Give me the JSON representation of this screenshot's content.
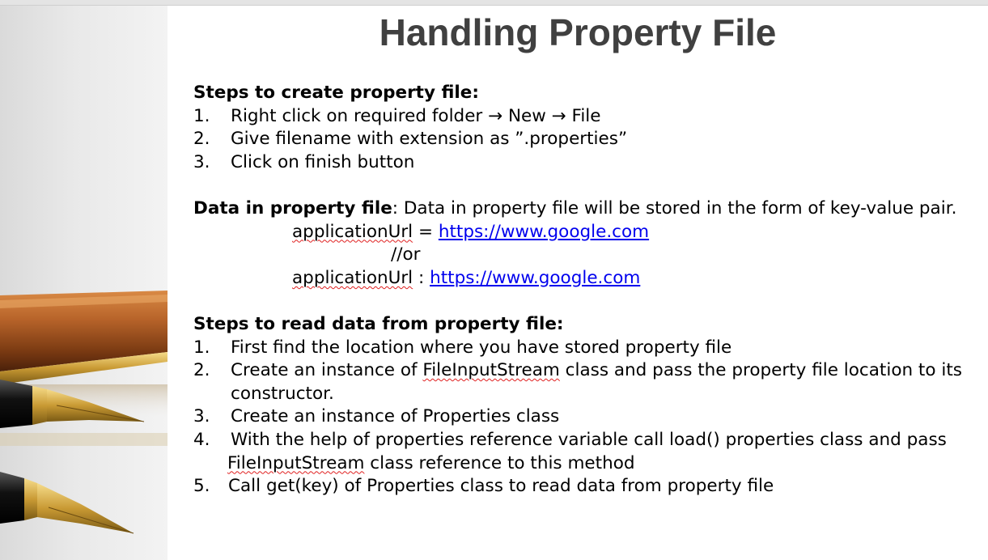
{
  "title": "Handling Property File",
  "section1": {
    "heading": "Steps to create property file:",
    "steps": [
      {
        "num": "1.",
        "text": "Right click on required folder → New → File"
      },
      {
        "num": "2.",
        "text": "Give filename with extension as ”.properties”"
      },
      {
        "num": "3.",
        "text": "Click on finish button"
      }
    ]
  },
  "section2": {
    "heading": "Data in property file",
    "description": ": Data in property file will be stored in the form of key-value pair.",
    "example1_key": "applicationUrl",
    "example1_sep": " = ",
    "example1_url": "https://www.google.com",
    "or_text": "//or",
    "example2_key": "applicationUrl",
    "example2_sep": " : ",
    "example2_url": "https://www.google.com"
  },
  "section3": {
    "heading": "Steps to read data from property file:",
    "step1": {
      "num": "1.",
      "text": "First find the location where you have stored property file"
    },
    "step2": {
      "num": "2.",
      "pre": "Create an instance of ",
      "class": "FileInputStream",
      "post": " class and pass the property file location to its",
      "cont": "constructor."
    },
    "step3": {
      "num": "3.",
      "text": "Create an instance of Properties class"
    },
    "step4": {
      "num": "4.",
      "text": "With the help of properties reference variable call load() properties class and pass",
      "cont_class": "FileInputStream",
      "cont_post": " class reference to this method"
    },
    "step5": {
      "num": "5.",
      "text": "Call get(key) of Properties class to read data from property file"
    }
  }
}
